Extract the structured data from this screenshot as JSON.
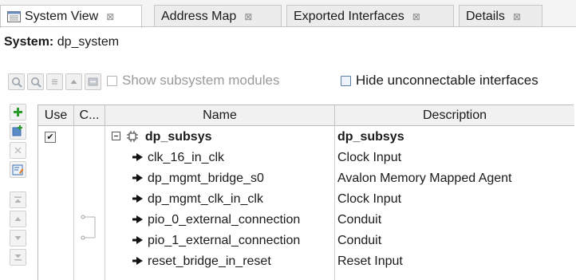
{
  "tabs": [
    {
      "label": "System View",
      "close": "⊠",
      "active": true
    },
    {
      "label": "Address Map",
      "close": "⊠",
      "active": false
    },
    {
      "label": "Exported Interfaces",
      "close": "⊠",
      "active": false
    },
    {
      "label": "Details",
      "close": "⊠",
      "active": false
    }
  ],
  "system": {
    "prefix": "System:",
    "name": "dp_system"
  },
  "toolbar": {
    "show_subsystem_label": "Show subsystem modules",
    "hide_unconnectable_label": "Hide unconnectable interfaces"
  },
  "table": {
    "headers": {
      "use": "Use",
      "conn": "C...",
      "name": "Name",
      "description": "Description"
    },
    "rows": [
      {
        "name": "dp_subsys",
        "description": "dp_subsys",
        "use_checked": true,
        "bold": true,
        "expander": true
      },
      {
        "name": "clk_16_in_clk",
        "description": "Clock Input"
      },
      {
        "name": "dp_mgmt_bridge_s0",
        "description": "Avalon Memory Mapped Agent"
      },
      {
        "name": "dp_mgmt_clk_in_clk",
        "description": "Clock Input"
      },
      {
        "name": "pio_0_external_connection",
        "description": "Conduit"
      },
      {
        "name": "pio_1_external_connection",
        "description": "Conduit"
      },
      {
        "name": "reset_bridge_in_reset",
        "description": "Reset Input"
      }
    ],
    "check_mark": "✔"
  },
  "colors": {
    "accent_green": "#2e9b2e",
    "accent_blue": "#3a6fb5",
    "border": "#b9b9b9"
  }
}
